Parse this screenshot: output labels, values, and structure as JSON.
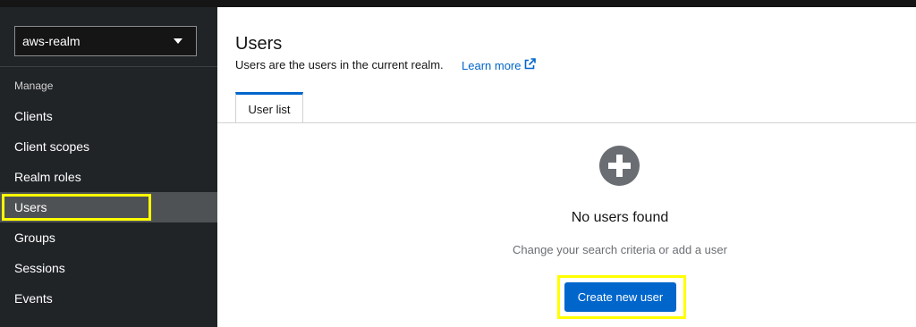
{
  "realm_selector": {
    "value": "aws-realm"
  },
  "sidebar": {
    "section_title": "Manage",
    "items": [
      {
        "label": "Clients"
      },
      {
        "label": "Client scopes"
      },
      {
        "label": "Realm roles"
      },
      {
        "label": "Users",
        "active": true
      },
      {
        "label": "Groups"
      },
      {
        "label": "Sessions"
      },
      {
        "label": "Events"
      }
    ]
  },
  "header": {
    "title": "Users",
    "description": "Users are the users in the current realm.",
    "learn_more": "Learn more"
  },
  "tabs": [
    {
      "label": "User list",
      "active": true
    }
  ],
  "empty_state": {
    "icon": "plus-circle-icon",
    "title": "No users found",
    "subtitle": "Change your search criteria or add a user",
    "button_label": "Create new user"
  },
  "colors": {
    "sidebar_bg": "#212427",
    "active_item_bg": "#4f5255",
    "primary": "#0066cc",
    "highlight": "#ffff00"
  }
}
